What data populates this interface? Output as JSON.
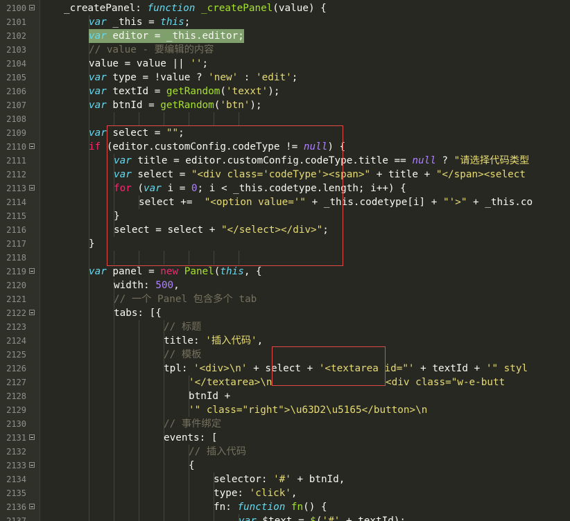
{
  "editor": {
    "theme": "monokai",
    "colors": {
      "background": "#272822",
      "gutter": "#2f3129",
      "keyword": "#66d9ef",
      "control": "#f92672",
      "string": "#e6db74",
      "number": "#ae81ff",
      "function": "#a6e22e",
      "comment": "#75715e",
      "annotation_box": "#e24a4a"
    },
    "lines": [
      {
        "n": "2100",
        "fold": true,
        "indent": 1,
        "tokens": [
          [
            "p",
            "_createPanel"
          ],
          [
            "o",
            ": "
          ],
          [
            "k",
            "function"
          ],
          [
            "o",
            " "
          ],
          [
            "f",
            "_createPanel"
          ],
          [
            "o",
            "(value) {"
          ]
        ]
      },
      {
        "n": "2101",
        "fold": false,
        "indent": 2,
        "tokens": [
          [
            "k",
            "var"
          ],
          [
            "o",
            " _this = "
          ],
          [
            "t",
            "this"
          ],
          [
            "o",
            ";"
          ]
        ]
      },
      {
        "n": "2102",
        "fold": false,
        "indent": 2,
        "tokens": [
          [
            "k",
            "var"
          ],
          [
            "o",
            " editor = _this.editor;"
          ]
        ],
        "selected": true
      },
      {
        "n": "2103",
        "fold": false,
        "indent": 2,
        "tokens": [
          [
            "c",
            "// value - 要编辑的内容"
          ]
        ]
      },
      {
        "n": "2104",
        "fold": false,
        "indent": 2,
        "tokens": [
          [
            "o",
            "value = value || "
          ],
          [
            "s",
            "''"
          ],
          [
            "o",
            ";"
          ]
        ]
      },
      {
        "n": "2105",
        "fold": false,
        "indent": 2,
        "tokens": [
          [
            "k",
            "var"
          ],
          [
            "o",
            " type = !value ? "
          ],
          [
            "s",
            "'new'"
          ],
          [
            "o",
            " : "
          ],
          [
            "s",
            "'edit'"
          ],
          [
            "o",
            ";"
          ]
        ]
      },
      {
        "n": "2106",
        "fold": false,
        "indent": 2,
        "tokens": [
          [
            "k",
            "var"
          ],
          [
            "o",
            " textId = "
          ],
          [
            "f",
            "getRandom"
          ],
          [
            "o",
            "("
          ],
          [
            "s",
            "'texxt'"
          ],
          [
            "o",
            ");"
          ]
        ]
      },
      {
        "n": "2107",
        "fold": false,
        "indent": 2,
        "tokens": [
          [
            "k",
            "var"
          ],
          [
            "o",
            " btnId = "
          ],
          [
            "f",
            "getRandom"
          ],
          [
            "o",
            "("
          ],
          [
            "s",
            "'btn'"
          ],
          [
            "o",
            ");"
          ]
        ]
      },
      {
        "n": "2108",
        "fold": false,
        "indent": 2,
        "tokens": []
      },
      {
        "n": "2109",
        "fold": false,
        "indent": 2,
        "tokens": [
          [
            "k",
            "var"
          ],
          [
            "o",
            " select = "
          ],
          [
            "s",
            "\"\""
          ],
          [
            "o",
            ";"
          ]
        ]
      },
      {
        "n": "2110",
        "fold": true,
        "indent": 2,
        "tokens": [
          [
            "x",
            "if"
          ],
          [
            "o",
            " (editor.customConfig.codeType != "
          ],
          [
            "b",
            "null"
          ],
          [
            "o",
            ") {"
          ]
        ]
      },
      {
        "n": "2111",
        "fold": false,
        "indent": 3,
        "tokens": [
          [
            "k",
            "var"
          ],
          [
            "o",
            " title = editor.customConfig.codeType.title == "
          ],
          [
            "b",
            "null"
          ],
          [
            "o",
            " ? "
          ],
          [
            "s",
            "\"请选择代码类型"
          ]
        ]
      },
      {
        "n": "2112",
        "fold": false,
        "indent": 3,
        "tokens": [
          [
            "k",
            "var"
          ],
          [
            "o",
            " select = "
          ],
          [
            "s",
            "\"<div class='codeType'><span>\""
          ],
          [
            "o",
            " + title + "
          ],
          [
            "s",
            "\"</span><select"
          ]
        ]
      },
      {
        "n": "2113",
        "fold": true,
        "indent": 3,
        "tokens": [
          [
            "x",
            "for"
          ],
          [
            "o",
            " ("
          ],
          [
            "k",
            "var"
          ],
          [
            "o",
            " i = "
          ],
          [
            "n",
            "0"
          ],
          [
            "o",
            "; i < _this.codetype.length; i++) {"
          ]
        ]
      },
      {
        "n": "2114",
        "fold": false,
        "indent": 4,
        "tokens": [
          [
            "o",
            "select +=  "
          ],
          [
            "s",
            "\"<option value='\""
          ],
          [
            "o",
            " + _this.codetype[i] + "
          ],
          [
            "s",
            "\"'>\""
          ],
          [
            "o",
            " + _this.co"
          ]
        ]
      },
      {
        "n": "2115",
        "fold": false,
        "indent": 3,
        "tokens": [
          [
            "o",
            "}"
          ]
        ]
      },
      {
        "n": "2116",
        "fold": false,
        "indent": 3,
        "tokens": [
          [
            "o",
            "select = select + "
          ],
          [
            "s",
            "\"</select></div>\""
          ],
          [
            "o",
            ";"
          ]
        ]
      },
      {
        "n": "2117",
        "fold": false,
        "indent": 2,
        "tokens": [
          [
            "o",
            "}"
          ]
        ]
      },
      {
        "n": "2118",
        "fold": false,
        "indent": 2,
        "tokens": []
      },
      {
        "n": "2119",
        "fold": true,
        "indent": 2,
        "tokens": [
          [
            "k",
            "var"
          ],
          [
            "o",
            " panel = "
          ],
          [
            "x",
            "new"
          ],
          [
            "o",
            " "
          ],
          [
            "f",
            "Panel"
          ],
          [
            "o",
            "("
          ],
          [
            "t",
            "this"
          ],
          [
            "o",
            ", {"
          ]
        ]
      },
      {
        "n": "2120",
        "fold": false,
        "indent": 3,
        "tokens": [
          [
            "o",
            "width: "
          ],
          [
            "n",
            "500"
          ],
          [
            "o",
            ","
          ]
        ]
      },
      {
        "n": "2121",
        "fold": false,
        "indent": 3,
        "tokens": [
          [
            "c",
            "// 一个 Panel 包含多个 tab"
          ]
        ]
      },
      {
        "n": "2122",
        "fold": true,
        "indent": 3,
        "tokens": [
          [
            "o",
            "tabs: [{"
          ]
        ]
      },
      {
        "n": "2123",
        "fold": false,
        "indent": 5,
        "tokens": [
          [
            "c",
            "// 标题"
          ]
        ]
      },
      {
        "n": "2124",
        "fold": false,
        "indent": 5,
        "tokens": [
          [
            "o",
            "title: "
          ],
          [
            "s",
            "'插入代码'"
          ],
          [
            "o",
            ","
          ]
        ]
      },
      {
        "n": "2125",
        "fold": false,
        "indent": 5,
        "tokens": [
          [
            "c",
            "// 模板"
          ]
        ]
      },
      {
        "n": "2126",
        "fold": false,
        "indent": 5,
        "tokens": [
          [
            "o",
            "tpl: "
          ],
          [
            "s",
            "'<div>\\n'"
          ],
          [
            "o",
            " + select + "
          ],
          [
            "s",
            "'<textarea id=\"'"
          ],
          [
            "o",
            " + textId + "
          ],
          [
            "s",
            "'\" styl"
          ]
        ]
      },
      {
        "n": "2127",
        "fold": false,
        "indent": 6,
        "tokens": [
          [
            "s",
            "'</textarea>\\n                   <div class=\"w-e-butt"
          ]
        ]
      },
      {
        "n": "2128",
        "fold": false,
        "indent": 6,
        "tokens": [
          [
            "o",
            "btnId +"
          ]
        ]
      },
      {
        "n": "2129",
        "fold": false,
        "indent": 6,
        "tokens": [
          [
            "s",
            "'\" class=\"right\">\\u63D2\\u5165</button>\\n"
          ]
        ]
      },
      {
        "n": "2130",
        "fold": false,
        "indent": 5,
        "tokens": [
          [
            "c",
            "// 事件绑定"
          ]
        ]
      },
      {
        "n": "2131",
        "fold": true,
        "indent": 5,
        "tokens": [
          [
            "o",
            "events: ["
          ]
        ]
      },
      {
        "n": "2132",
        "fold": false,
        "indent": 6,
        "tokens": [
          [
            "c",
            "// 插入代码"
          ]
        ]
      },
      {
        "n": "2133",
        "fold": true,
        "indent": 6,
        "tokens": [
          [
            "o",
            "{"
          ]
        ]
      },
      {
        "n": "2134",
        "fold": false,
        "indent": 7,
        "tokens": [
          [
            "o",
            "selector: "
          ],
          [
            "s",
            "'#'"
          ],
          [
            "o",
            " + btnId,"
          ]
        ]
      },
      {
        "n": "2135",
        "fold": false,
        "indent": 7,
        "tokens": [
          [
            "o",
            "type: "
          ],
          [
            "s",
            "'click'"
          ],
          [
            "o",
            ","
          ]
        ]
      },
      {
        "n": "2136",
        "fold": true,
        "indent": 7,
        "tokens": [
          [
            "o",
            "fn: "
          ],
          [
            "k",
            "function"
          ],
          [
            "o",
            " "
          ],
          [
            "f",
            "fn"
          ],
          [
            "o",
            "() {"
          ]
        ]
      },
      {
        "n": "2137",
        "fold": false,
        "indent": 8,
        "tokens": [
          [
            "k",
            "var"
          ],
          [
            "o",
            " $text = "
          ],
          [
            "f",
            "$"
          ],
          [
            "o",
            "("
          ],
          [
            "s",
            "'#'"
          ],
          [
            "o",
            " + textId);"
          ]
        ]
      }
    ]
  }
}
